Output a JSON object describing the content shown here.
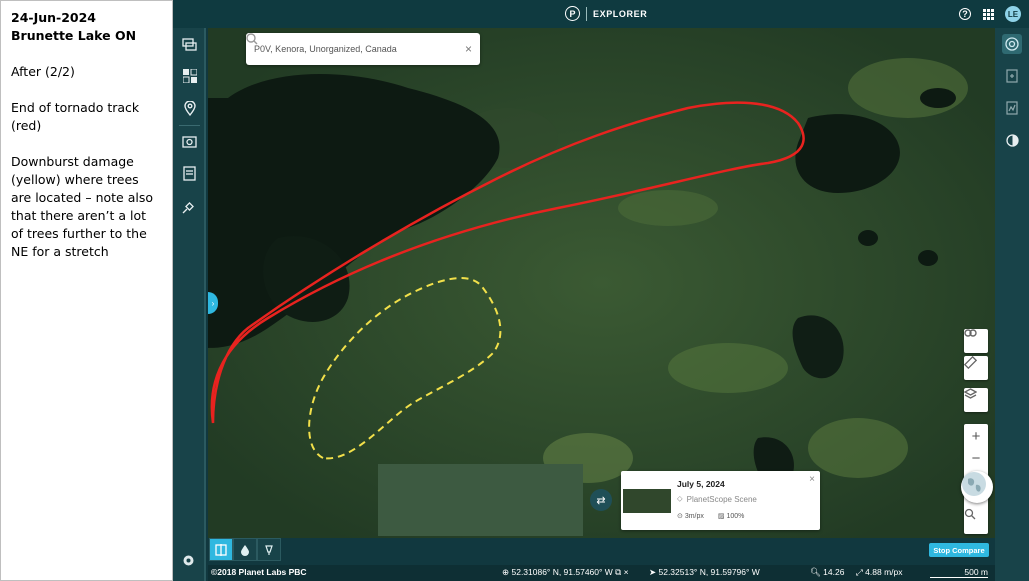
{
  "notes": {
    "title": "24-Jun-2024 Brunette Lake ON",
    "after": "After (2/2)",
    "end_track": "End of tornado track (red)",
    "downburst": "Downburst damage (yellow) where trees are located – note also that there aren’t a lot of trees further to the NE for a stretch"
  },
  "app": {
    "logo_letter": "P",
    "name": "EXPLORER",
    "user_initials": "LE"
  },
  "search": {
    "value": "P0V, Kenora, Unorganized, Canada",
    "placeholder": "Search"
  },
  "compare_card": {
    "date": "July 5, 2024",
    "source": "PlanetScope Scene",
    "resolution": "3m/px",
    "coverage": "100%"
  },
  "status": {
    "copyright": "©2018 Planet Labs PBC",
    "coord1": "52.31086° N, 91.57460° W",
    "coord2": "52.32513° N, 91.59796° W",
    "zoom": "14.26",
    "mpx": "4.88 m/px",
    "scale": "500 m"
  },
  "buttons": {
    "stop_compare": "Stop Compare"
  },
  "colors": {
    "tornado_track": "#e8231f",
    "downburst": "#f2e04a",
    "accent": "#2fb8e0"
  }
}
